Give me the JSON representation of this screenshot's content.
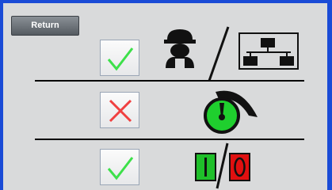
{
  "screen": {
    "return_label": "Return"
  },
  "rows": [
    {
      "name": "operator-network",
      "status": "ok",
      "status_icon": "checkmark-icon"
    },
    {
      "name": "gauge",
      "status": "fault",
      "status_icon": "cross-icon"
    },
    {
      "name": "start-stop",
      "status": "ok",
      "status_icon": "checkmark-icon"
    }
  ],
  "colors": {
    "frame": "#1a4bd6",
    "panel": "#d9dadb",
    "ok": "#3de04a",
    "fault": "#f04040",
    "gauge_green": "#1fcf2e",
    "start_green": "#1fbf2a",
    "stop_red": "#e01010"
  }
}
